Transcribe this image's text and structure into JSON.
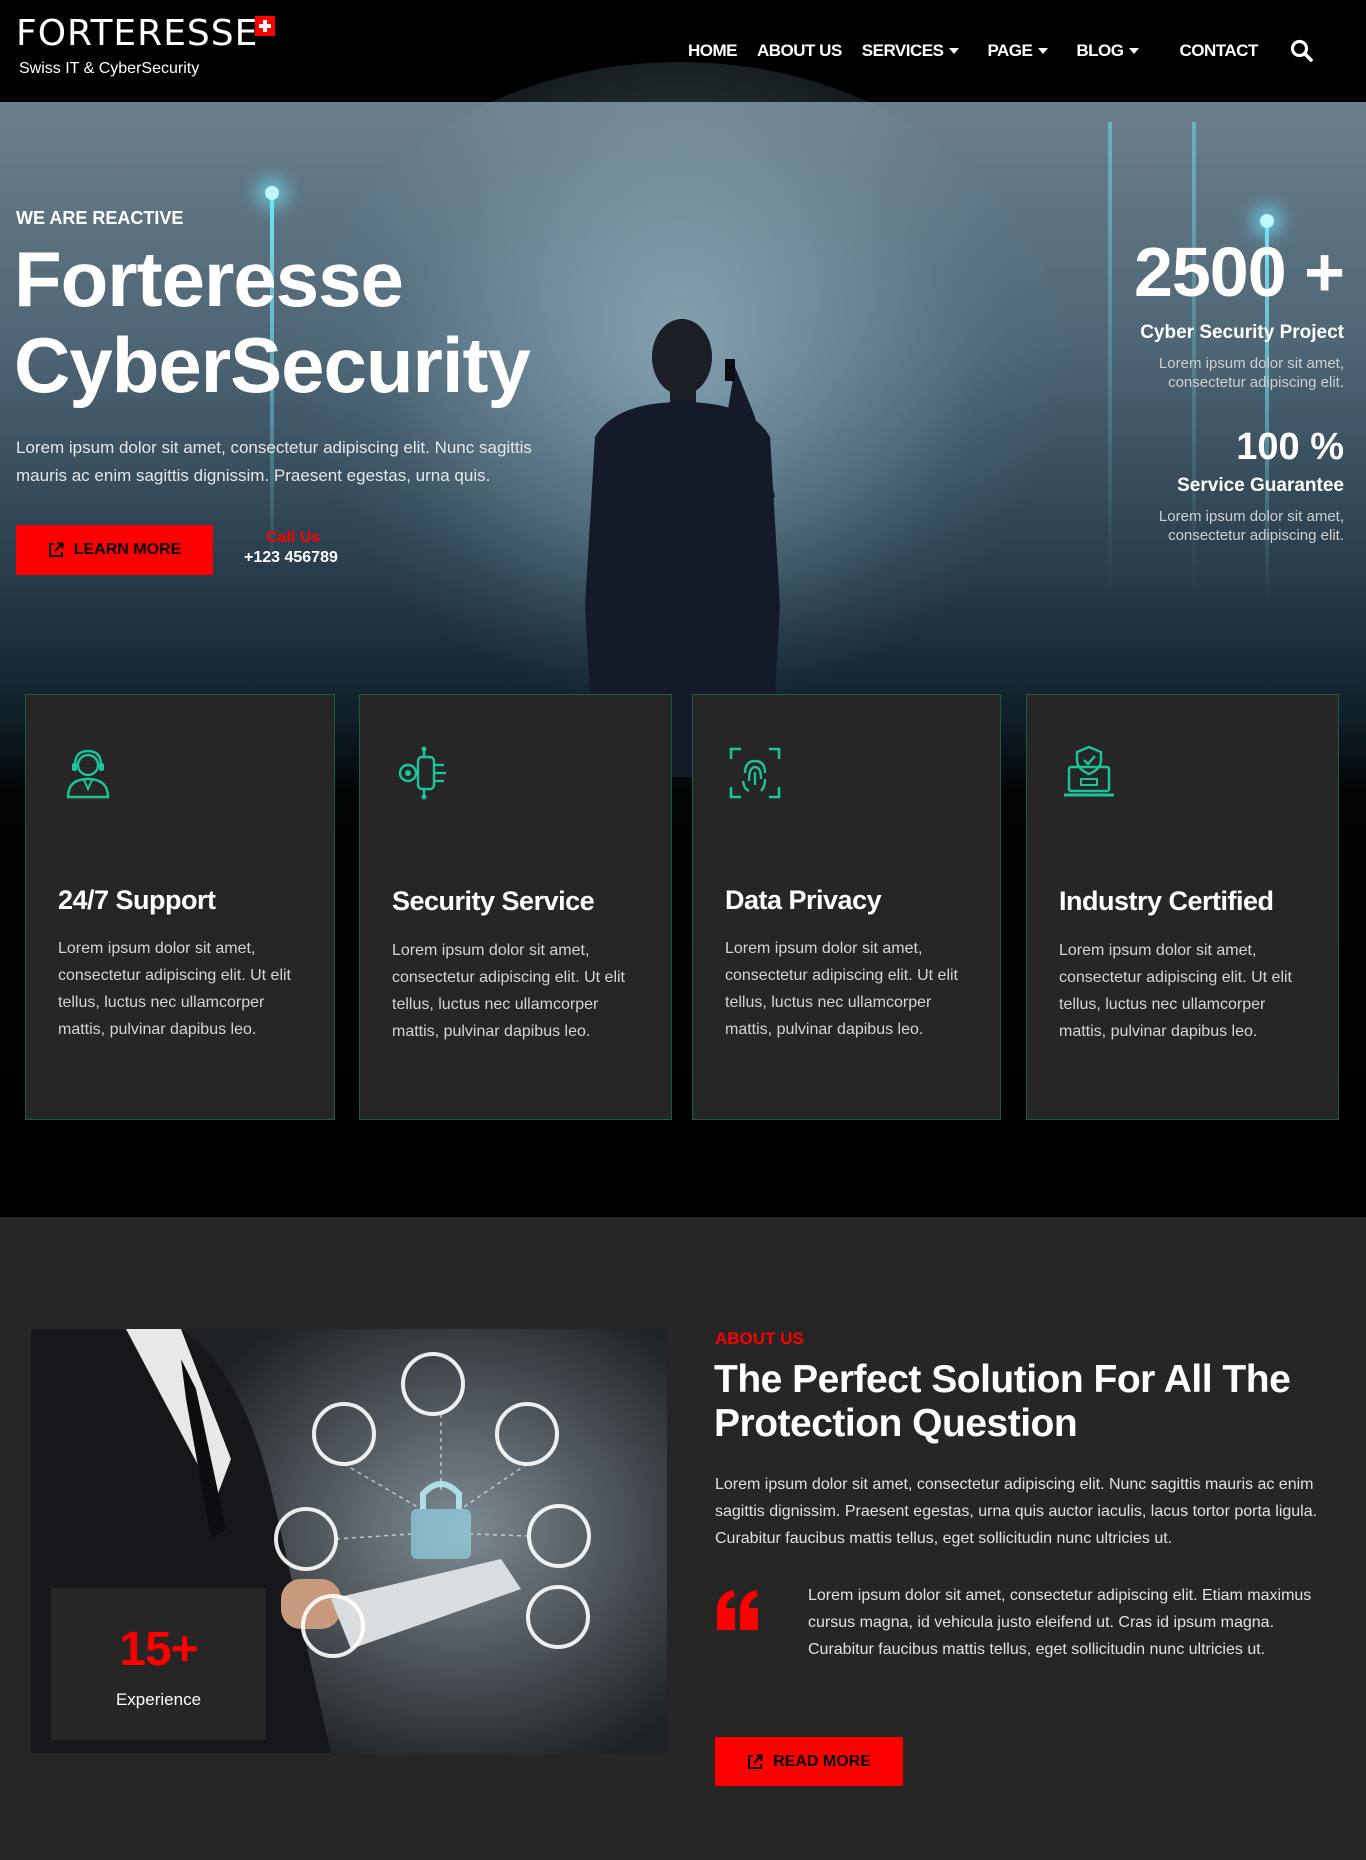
{
  "brand": {
    "name": "FORTERESSE",
    "tagline": "Swiss IT & CyberSecurity"
  },
  "nav": {
    "items": [
      {
        "label": "HOME",
        "dropdown": false
      },
      {
        "label": "ABOUT US",
        "dropdown": false
      },
      {
        "label": "SERVICES",
        "dropdown": true
      },
      {
        "label": "PAGE",
        "dropdown": true
      },
      {
        "label": "BLOG",
        "dropdown": true
      },
      {
        "label": "CONTACT",
        "dropdown": false
      }
    ],
    "search_icon": "search-icon"
  },
  "hero": {
    "eyebrow": "WE ARE REACTIVE",
    "title_line1": "Forteresse",
    "title_line2": "CyberSecurity",
    "text": "Lorem ipsum dolor sit amet, consectetur adipiscing elit. Nunc sagittis mauris ac enim sagittis dignissim. Praesent egestas, urna quis.",
    "cta_label": "LEARN MORE",
    "call_label": "Call Us",
    "call_number": "+123 456789",
    "stats": [
      {
        "value": "2500 +",
        "title": "Cyber Security Project",
        "desc": "Lorem ipsum dolor sit amet, consectetur adipiscing elit."
      },
      {
        "value": "100 %",
        "title": "Service Guarantee",
        "desc": "Lorem ipsum dolor sit amet, consectetur adipiscing elit."
      }
    ]
  },
  "features": [
    {
      "icon": "support-agent-icon",
      "title": "24/7 Support",
      "text": "Lorem ipsum dolor sit amet, consectetur adipiscing elit. Ut elit tellus, luctus nec ullamcorper mattis, pulvinar dapibus leo."
    },
    {
      "icon": "circuit-key-icon",
      "title": "Security Service",
      "text": "Lorem ipsum dolor sit amet, consectetur adipiscing elit. Ut elit tellus, luctus nec ullamcorper mattis, pulvinar dapibus leo."
    },
    {
      "icon": "fingerprint-scan-icon",
      "title": "Data Privacy",
      "text": "Lorem ipsum dolor sit amet, consectetur adipiscing elit. Ut elit tellus, luctus nec ullamcorper mattis, pulvinar dapibus leo."
    },
    {
      "icon": "shield-laptop-icon",
      "title": "Industry Certified",
      "text": "Lorem ipsum dolor sit amet, consectetur adipiscing elit. Ut elit tellus, luctus nec ullamcorper mattis, pulvinar dapibus leo."
    }
  ],
  "about": {
    "eyebrow": "ABOUT US",
    "title": "The Perfect Solution For All The Protection Question",
    "text": "Lorem ipsum dolor sit amet, consectetur adipiscing elit. Nunc sagittis mauris ac enim sagittis dignissim. Praesent egestas, urna quis auctor iaculis, lacus tortor porta ligula. Curabitur faucibus mattis tellus, eget sollicitudin nunc ultricies ut.",
    "quote": "Lorem ipsum dolor sit amet, consectetur adipiscing elit. Etiam maximus cursus magna, id vehicula justo eleifend ut. Cras id ipsum magna. Curabitur faucibus mattis tellus, eget sollicitudin nunc ultricies ut.",
    "experience_value": "15+",
    "experience_label": "Experience",
    "cta_label": "READ MORE"
  },
  "colors": {
    "accent": "#ff0000",
    "icon_green": "#1fc39a",
    "card_bg": "#262626",
    "section_bg": "#262626"
  }
}
